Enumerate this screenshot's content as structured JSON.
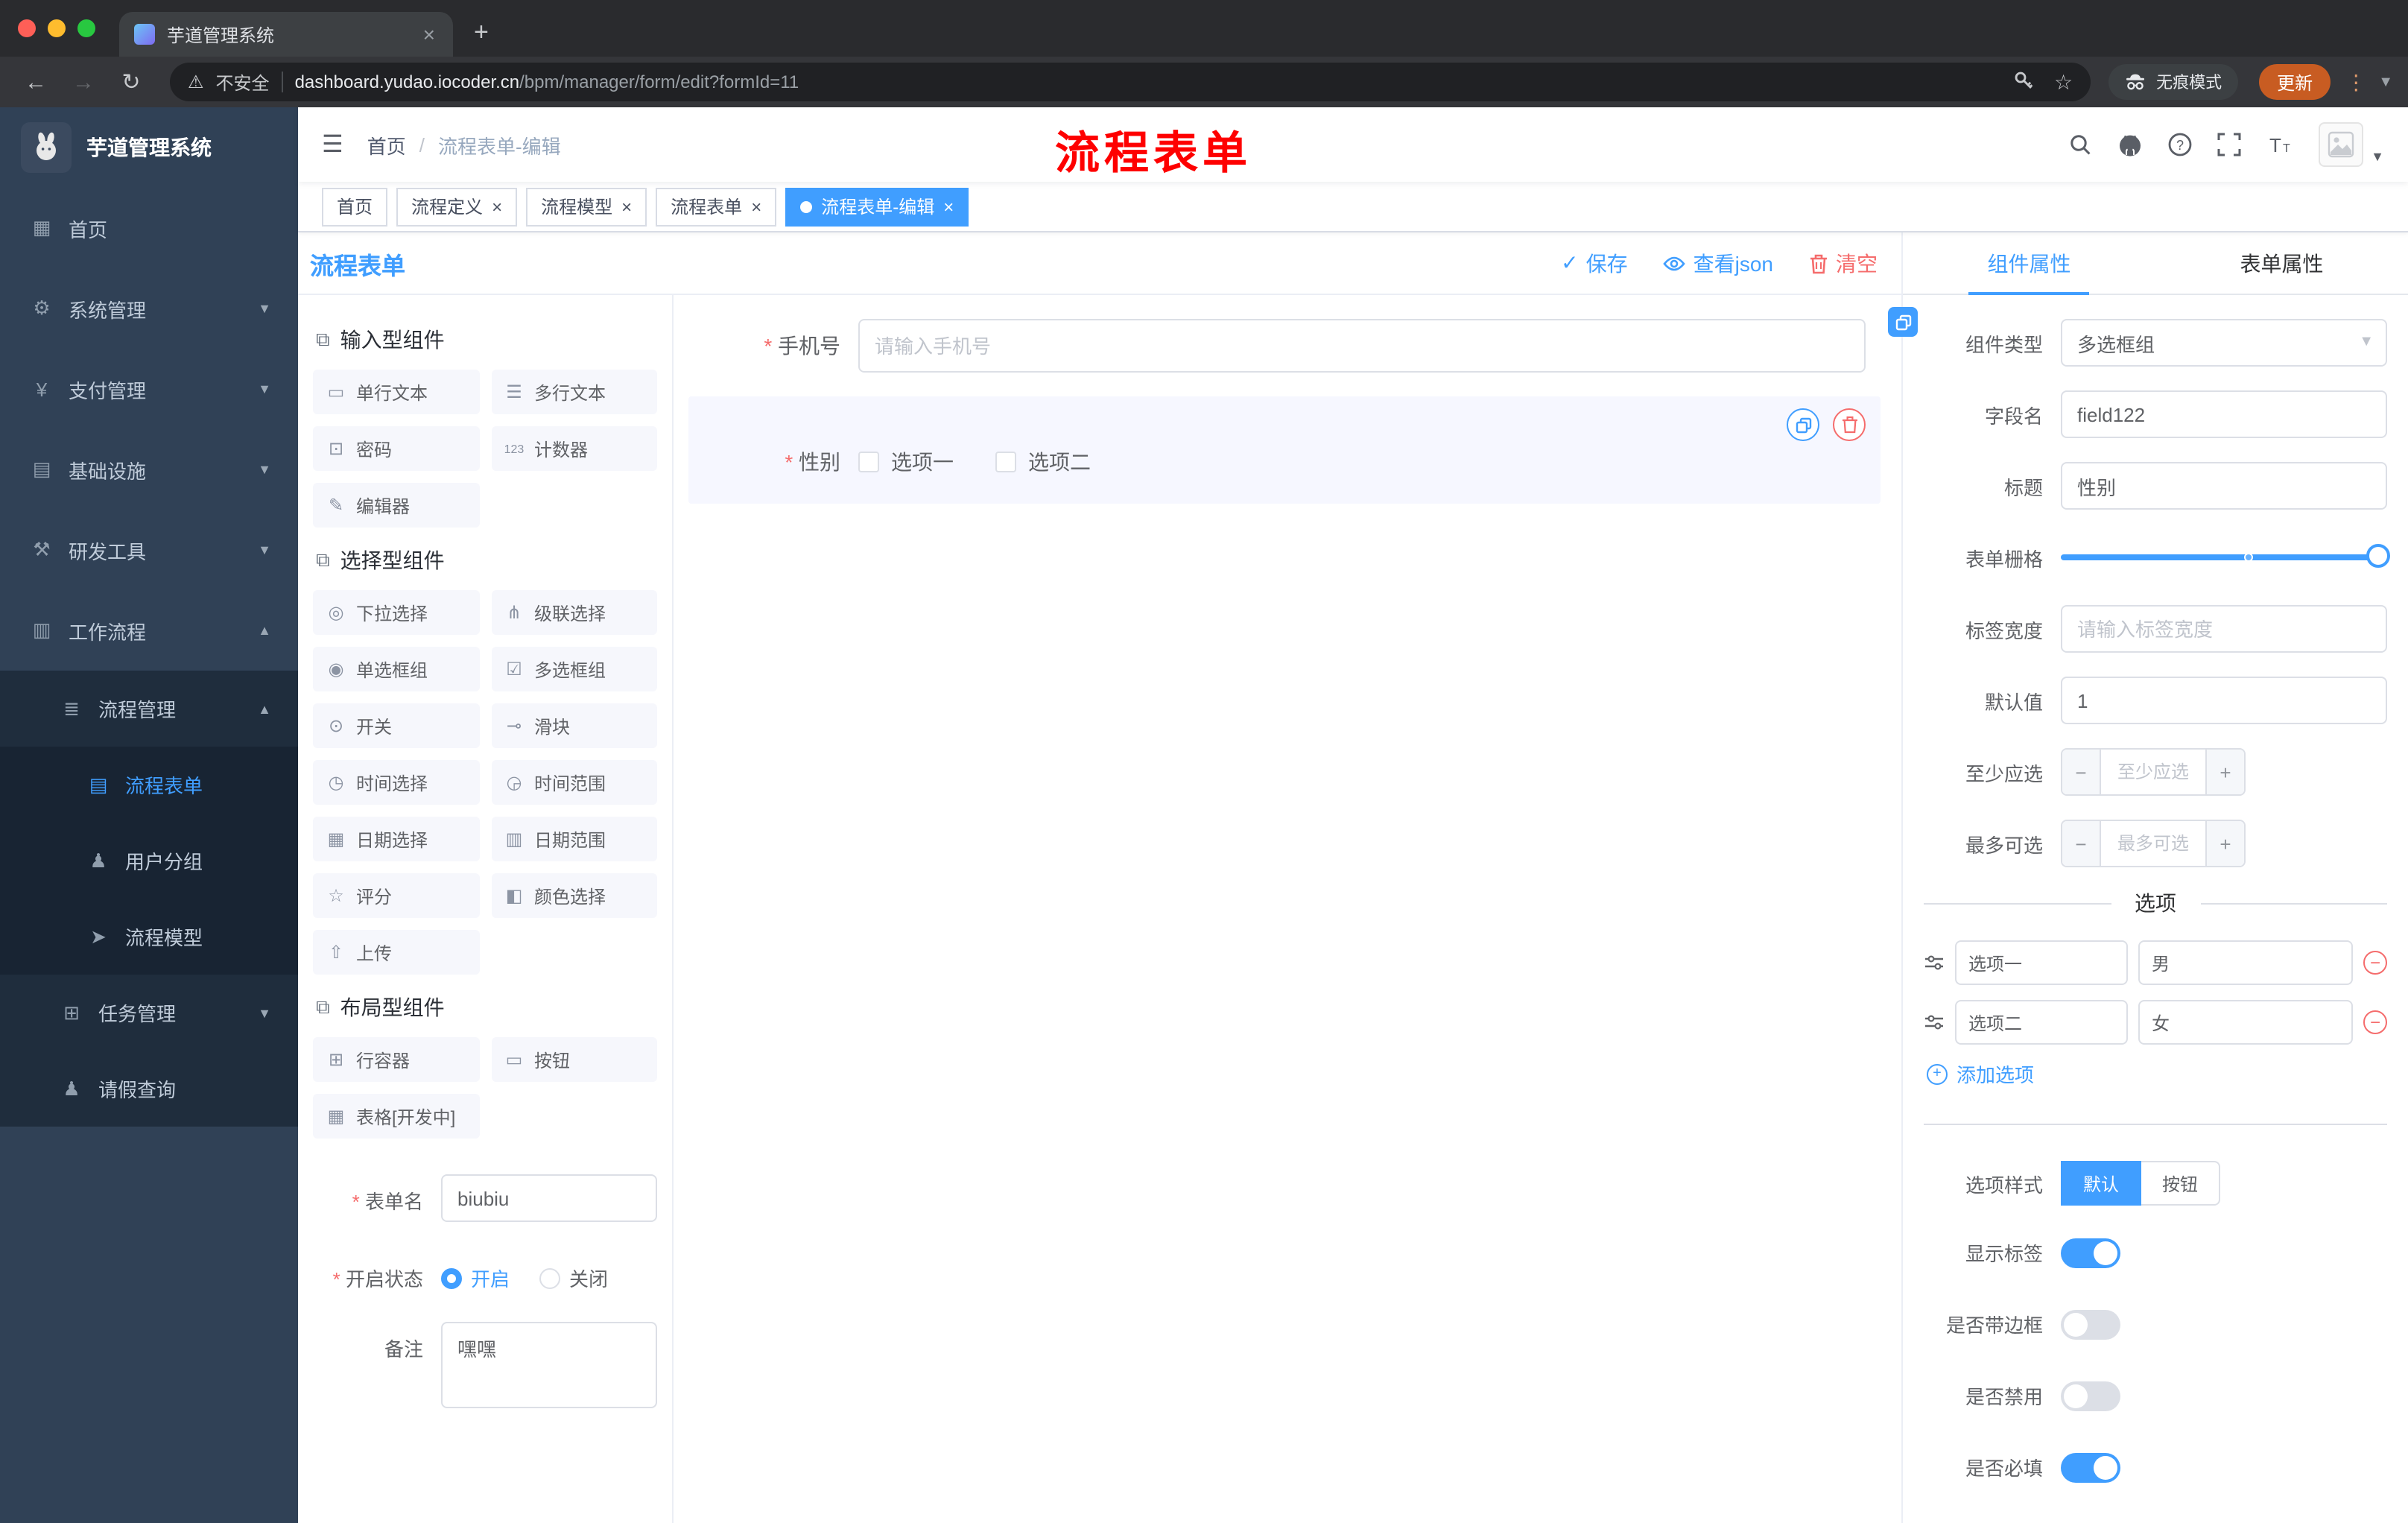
{
  "colors": {
    "accent": "#409eff",
    "danger": "#f56c6c",
    "sidebar_bg": "#304156",
    "sidebar_sub_bg": "#1f2d3d",
    "active_tag_bg": "#409eff",
    "update_pill": "#c85c22",
    "annotation": "#fe0000"
  },
  "browser": {
    "tab_title": "芋道管理系统",
    "security_label": "不安全",
    "url_host": "dashboard.yudao.iocoder.cn",
    "url_path": "/bpm/manager/form/edit?formId=11",
    "incognito_label": "无痕模式",
    "update_label": "更新"
  },
  "sidebar": {
    "title": "芋道管理系统",
    "items": [
      {
        "label": "首页",
        "icon": "dashboard"
      },
      {
        "label": "系统管理",
        "icon": "gear",
        "chevron": "down"
      },
      {
        "label": "支付管理",
        "icon": "yen",
        "chevron": "down"
      },
      {
        "label": "基础设施",
        "icon": "infra",
        "chevron": "down"
      },
      {
        "label": "研发工具",
        "icon": "tools",
        "chevron": "down"
      },
      {
        "label": "工作流程",
        "icon": "workflow",
        "chevron": "up"
      },
      {
        "label": "流程管理",
        "icon": "list",
        "chevron": "up",
        "l2": true
      },
      {
        "label": "流程表单",
        "icon": "doc",
        "l3": true,
        "active": true
      },
      {
        "label": "用户分组",
        "icon": "users",
        "l3": true
      },
      {
        "label": "流程模型",
        "icon": "send",
        "l3": true
      },
      {
        "label": "任务管理",
        "icon": "tasks",
        "chevron": "down",
        "l2": true
      },
      {
        "label": "请假查询",
        "icon": "person",
        "l2": true
      }
    ]
  },
  "header": {
    "breadcrumb_home": "首页",
    "breadcrumb_current": "流程表单-编辑",
    "annotation": "流程表单"
  },
  "tags": {
    "items": [
      {
        "label": "首页"
      },
      {
        "label": "流程定义",
        "closable": true
      },
      {
        "label": "流程模型",
        "closable": true
      },
      {
        "label": "流程表单",
        "closable": true
      },
      {
        "label": "流程表单-编辑",
        "closable": true,
        "active": true
      }
    ]
  },
  "editor": {
    "title": "流程表单",
    "actions": {
      "save": "保存",
      "view_json": "查看json",
      "clear": "清空"
    },
    "palette": {
      "groups": [
        {
          "title": "输入型组件",
          "items": [
            {
              "label": "单行文本",
              "icon": "text-field"
            },
            {
              "label": "多行文本",
              "icon": "textarea"
            },
            {
              "label": "密码",
              "icon": "password"
            },
            {
              "label": "计数器",
              "icon": "counter"
            },
            {
              "label": "编辑器",
              "icon": "editor"
            }
          ]
        },
        {
          "title": "选择型组件",
          "items": [
            {
              "label": "下拉选择",
              "icon": "select"
            },
            {
              "label": "级联选择",
              "icon": "cascader"
            },
            {
              "label": "单选框组",
              "icon": "radio"
            },
            {
              "label": "多选框组",
              "icon": "checkbox"
            },
            {
              "label": "开关",
              "icon": "switch"
            },
            {
              "label": "滑块",
              "icon": "slider"
            },
            {
              "label": "时间选择",
              "icon": "time"
            },
            {
              "label": "时间范围",
              "icon": "time-range"
            },
            {
              "label": "日期选择",
              "icon": "date"
            },
            {
              "label": "日期范围",
              "icon": "date-range"
            },
            {
              "label": "评分",
              "icon": "rate"
            },
            {
              "label": "颜色选择",
              "icon": "color"
            },
            {
              "label": "上传",
              "icon": "upload"
            }
          ]
        },
        {
          "title": "布局型组件",
          "items": [
            {
              "label": "行容器",
              "icon": "row"
            },
            {
              "label": "按钮",
              "icon": "button"
            },
            {
              "label": "表格[开发中]",
              "icon": "table"
            }
          ]
        }
      ]
    },
    "meta": {
      "name_label": "表单名",
      "name_value": "biubiu",
      "status_label": "开启状态",
      "status_options": [
        {
          "label": "开启",
          "checked": true
        },
        {
          "label": "关闭"
        }
      ],
      "remark_label": "备注",
      "remark_value": "嘿嘿"
    },
    "canvas": {
      "phone": {
        "label": "手机号",
        "placeholder": "请输入手机号"
      },
      "gender": {
        "label": "性别",
        "options": [
          {
            "label": "选项一"
          },
          {
            "label": "选项二"
          }
        ]
      }
    }
  },
  "props": {
    "tabs": [
      {
        "label": "组件属性",
        "active": true
      },
      {
        "label": "表单属性"
      }
    ],
    "component_type": {
      "label": "组件类型",
      "value": "多选框组"
    },
    "field_name": {
      "label": "字段名",
      "value": "field122"
    },
    "title_field": {
      "label": "标题",
      "value": "性别"
    },
    "grid": {
      "label": "表单栅格"
    },
    "label_width": {
      "label": "标签宽度",
      "placeholder": "请输入标签宽度"
    },
    "default_value": {
      "label": "默认值",
      "value": "1"
    },
    "min_select": {
      "label": "至少应选",
      "placeholder": "至少应选"
    },
    "max_select": {
      "label": "最多可选",
      "placeholder": "最多可选"
    },
    "options": {
      "title": "选项",
      "rows": [
        {
          "name": "选项一",
          "value": "男"
        },
        {
          "name": "选项二",
          "value": "女"
        }
      ],
      "add_label": "添加选项"
    },
    "style": {
      "label": "选项样式",
      "options": [
        {
          "label": "默认",
          "active": true
        },
        {
          "label": "按钮"
        }
      ]
    },
    "toggles": [
      {
        "label": "显示标签",
        "on": true
      },
      {
        "label": "是否带边框"
      },
      {
        "label": "是否禁用"
      },
      {
        "label": "是否必填",
        "on": true
      }
    ]
  }
}
